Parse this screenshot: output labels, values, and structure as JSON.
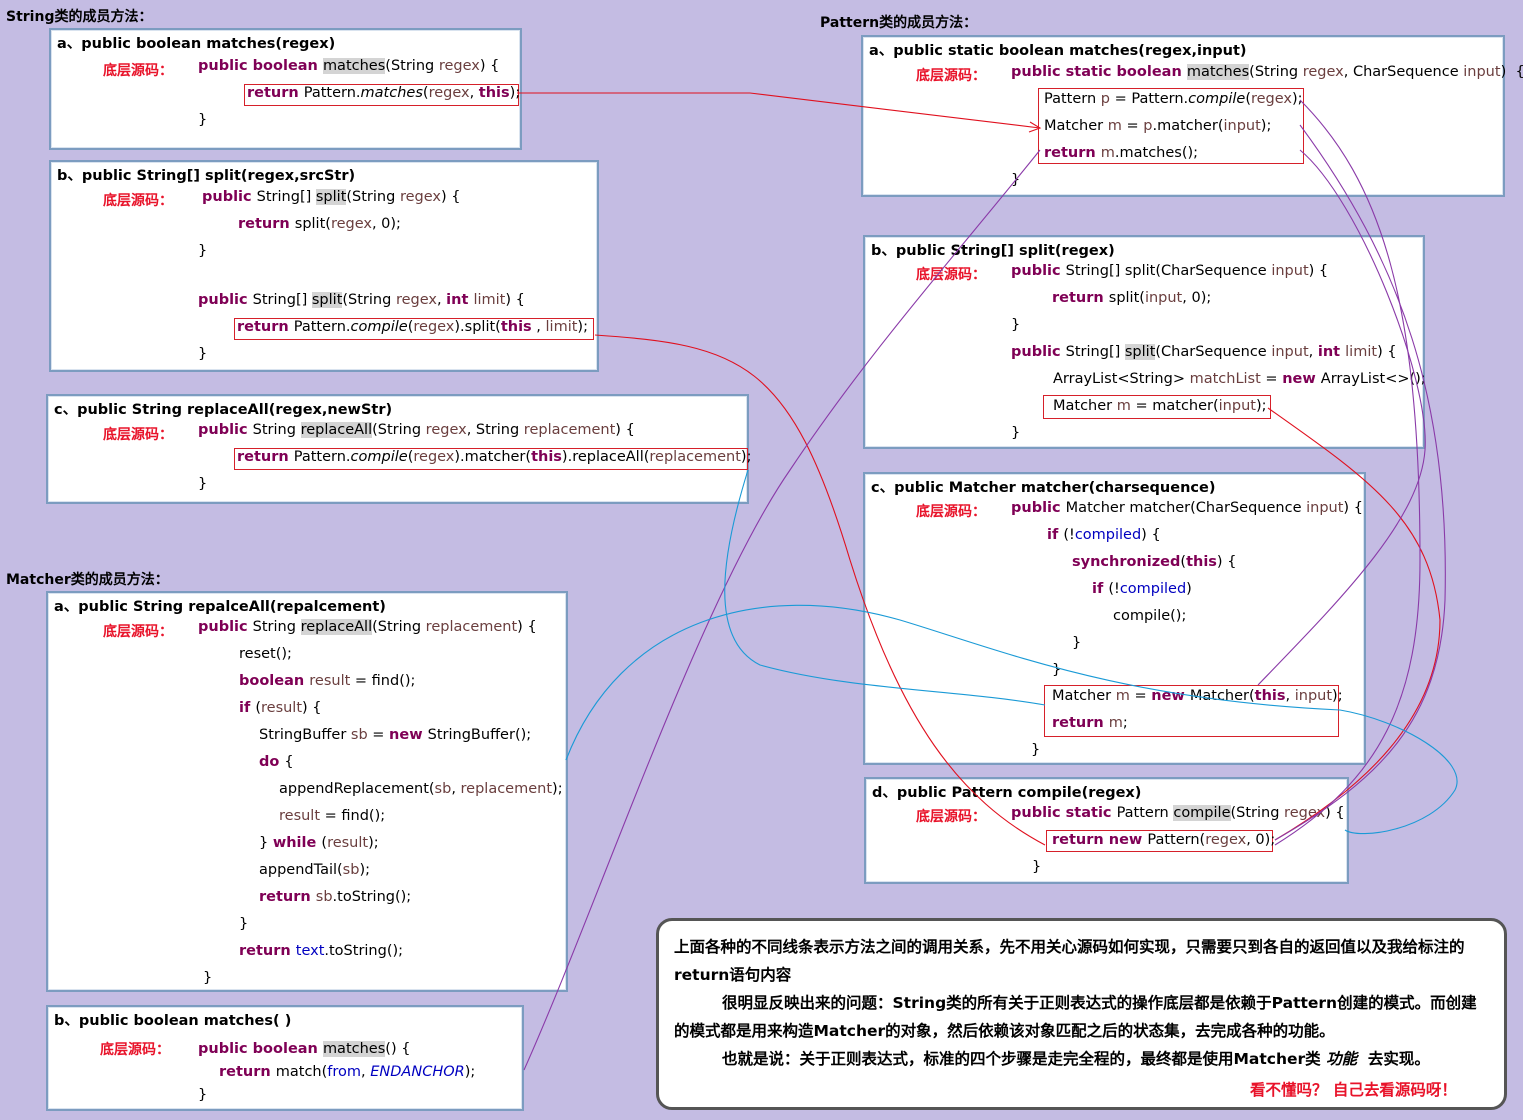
{
  "sections": {
    "string": "String类的成员方法：",
    "pattern": "Pattern类的成员方法：",
    "matcher": "Matcher类的成员方法："
  },
  "label": "底层源码：",
  "string_boxes": {
    "a": {
      "title": "a、public boolean matches(regex)",
      "l1": [
        "public boolean ",
        "matches",
        "(String ",
        "regex",
        ") {"
      ],
      "l2": [
        "return ",
        "Pattern.",
        "matches",
        "(",
        "regex",
        ", ",
        "this",
        ");"
      ],
      "l3": "}"
    },
    "b": {
      "title": "b、public String[] split(regex,srcStr)",
      "l1": [
        "public ",
        "String[] ",
        "split",
        "(String ",
        "regex",
        ") {"
      ],
      "l2": [
        "return ",
        "split(",
        "regex",
        ", 0);"
      ],
      "l3": "}",
      "l4": [
        "public ",
        "String[] ",
        "split",
        "(String ",
        "regex",
        ", ",
        "int ",
        "limit",
        ") {"
      ],
      "l5": [
        "return ",
        "Pattern.",
        "compile",
        "(",
        "regex",
        ").split(",
        "this",
        " , ",
        "limit",
        ");"
      ],
      "l6": "}"
    },
    "c": {
      "title": "c、public String replaceAll(regex,newStr)",
      "l1": [
        "public ",
        "String ",
        "replaceAll",
        "(String ",
        "regex",
        ", String ",
        "replacement",
        ") {"
      ],
      "l2": [
        "return ",
        "Pattern.",
        "compile",
        "(",
        "regex",
        ").matcher(",
        "this",
        ").replaceAll(",
        "replacement",
        ");"
      ],
      "l3": "}"
    }
  },
  "pattern_boxes": {
    "a": {
      "title": "a、public static boolean matches(regex,input)",
      "l1": [
        "public static boolean ",
        "matches",
        "(String ",
        "regex",
        ", CharSequence ",
        "input",
        ")  {"
      ],
      "l2": [
        "Pattern ",
        "p",
        " = Pattern.",
        "compile",
        "(",
        "regex",
        ");"
      ],
      "l3": [
        "Matcher ",
        "m",
        " = ",
        "p",
        ".matcher(",
        "input",
        ");"
      ],
      "l4": [
        "return ",
        "m",
        ".matches();"
      ],
      "l5": "}"
    },
    "b": {
      "title": "b、public String[] split(regex)",
      "l1": [
        "public ",
        "String[] split(CharSequence ",
        "input",
        ") {"
      ],
      "l2": [
        "return ",
        "split(",
        "input",
        ", 0);"
      ],
      "l3": "}",
      "l4": [
        "public ",
        "String[] ",
        "split",
        "(CharSequence ",
        "input",
        ", ",
        "int ",
        "limit",
        ") {"
      ],
      "l5": [
        "ArrayList<String> ",
        "matchList",
        " = ",
        "new ",
        "ArrayList<>();"
      ],
      "l6": [
        "Matcher ",
        "m",
        " = matcher(",
        "input",
        ");"
      ],
      "l7": "}"
    },
    "c": {
      "title": "c、public Matcher matcher(charsequence)",
      "l1": [
        "public ",
        "Matcher matcher(CharSequence ",
        "input",
        ") {"
      ],
      "l2": [
        "if ",
        "(!",
        "compiled",
        ") {"
      ],
      "l3": [
        "synchronized",
        "(",
        "this",
        ") {"
      ],
      "l4": [
        "if ",
        "(!",
        "compiled",
        ")"
      ],
      "l5": "compile();",
      "l6": "}",
      "l7": "}",
      "l8": [
        "Matcher ",
        "m",
        " = ",
        "new ",
        "Matcher(",
        "this",
        ", ",
        "input",
        ");"
      ],
      "l9": [
        "return ",
        "m",
        ";"
      ],
      "l10": "}"
    },
    "d": {
      "title": "d、public Pattern compile(regex)",
      "l1": [
        "public static ",
        "Pattern ",
        "compile",
        "(String ",
        "regex",
        ") {"
      ],
      "l2": [
        "return new ",
        "Pattern(",
        "regex",
        ", 0);"
      ],
      "l3": "}"
    }
  },
  "matcher_boxes": {
    "a": {
      "title": "a、public String repalceAll(repalcement)",
      "l1": [
        "public ",
        "String ",
        "replaceAll",
        "(String ",
        "replacement",
        ") {"
      ],
      "l2": "reset();",
      "l3": [
        "boolean ",
        "result",
        " = find();"
      ],
      "l4": [
        "if ",
        "(",
        "result",
        ") {"
      ],
      "l5": [
        "StringBuffer ",
        "sb",
        " = ",
        "new ",
        "StringBuffer();"
      ],
      "l6": [
        "do ",
        "{"
      ],
      "l7": [
        "appendReplacement(",
        "sb",
        ", ",
        "replacement",
        ");"
      ],
      "l8": [
        "result",
        " = find();"
      ],
      "l9": [
        "} ",
        "while ",
        "(",
        "result",
        ");"
      ],
      "l10": [
        "appendTail(",
        "sb",
        ");"
      ],
      "l11": [
        "return ",
        "sb",
        ".toString();"
      ],
      "l12": "}",
      "l13": [
        "return ",
        "text",
        ".toString();"
      ],
      "l14": "}"
    },
    "b": {
      "title": "b、public boolean matches( )",
      "l1": [
        "public boolean ",
        "matches",
        "() {"
      ],
      "l2": [
        "return ",
        "match(",
        "from",
        ", ",
        "ENDANCHOR",
        ");"
      ],
      "l3": "}"
    }
  },
  "note": {
    "p1a": "上面各种的不同线条表示方法之间的调用关系，先不用关心源码如何实现，只需要只到各自的返回值以及我给标注的",
    "p1b": "return语句内容",
    "p2a": "很明显反映出来的问题：String类的所有关于正则表达式的操作底层都是依赖于Pattern创建的模式。而创建",
    "p2b": "的模式都是用来构造Matcher的对象，然后依赖该对象匹配之后的状态集，去完成各种的功能。",
    "p3a": "也就是说：关于正则表达式，标准的四个步骤是走完全程的，最终都是使用Matcher类 ",
    "p3b": "功能",
    "p3c": "  去实现。",
    "p4": "看不懂吗？ 自己去看源码呀！"
  },
  "colors": {
    "background": "#c4bce3",
    "box_border": "#7c9cc0",
    "keyword": "#7f0055",
    "variable": "#6a3e3e",
    "field": "#0000c0",
    "label_red": "#e8132a",
    "line_red": "#e0101e",
    "line_purple": "#8a3aa8",
    "line_blue": "#1a9ad6"
  }
}
